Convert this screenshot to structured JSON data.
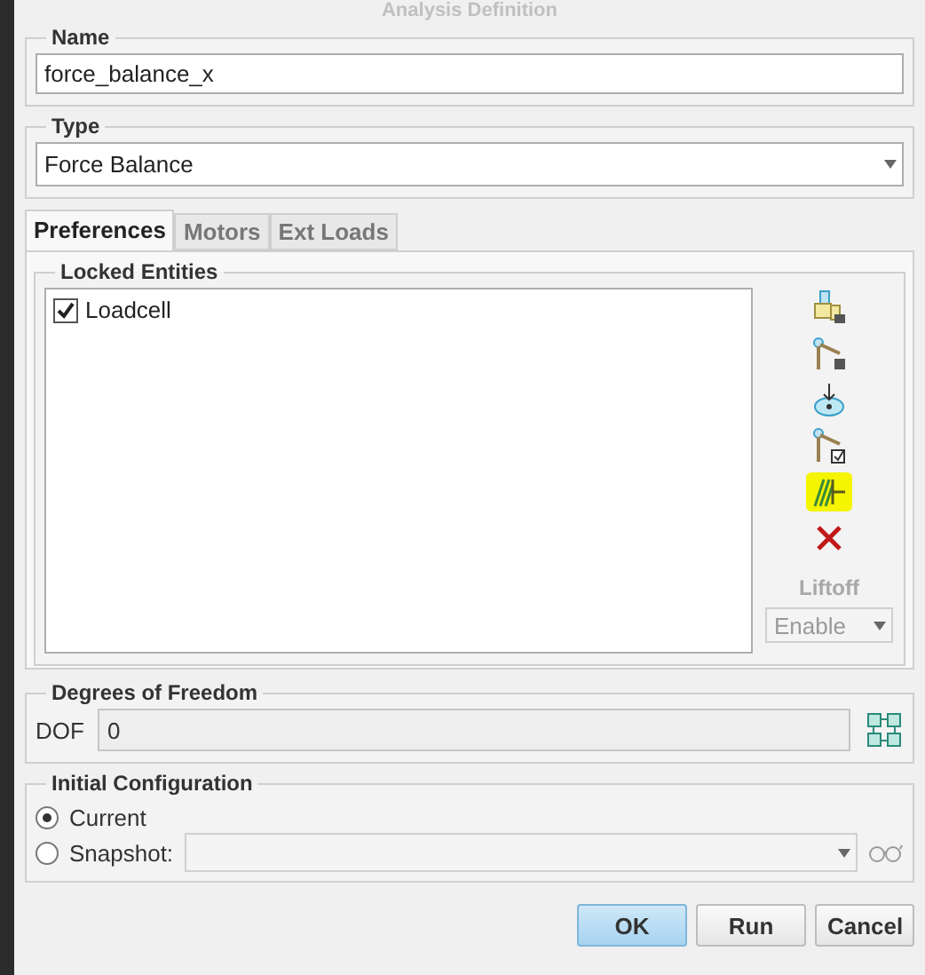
{
  "window": {
    "title": "Analysis Definition"
  },
  "name_group": {
    "label": "Name",
    "value": "force_balance_x"
  },
  "type_group": {
    "label": "Type",
    "value": "Force Balance"
  },
  "tabs": [
    {
      "label": "Preferences",
      "selected": true
    },
    {
      "label": "Motors",
      "selected": false
    },
    {
      "label": "Ext Loads",
      "selected": false
    }
  ],
  "locked_entities": {
    "label": "Locked Entities",
    "items": [
      {
        "label": "Loadcell",
        "checked": true
      }
    ],
    "tools": [
      {
        "kind": "body",
        "highlighted": false
      },
      {
        "kind": "link",
        "highlighted": false
      },
      {
        "kind": "point",
        "highlighted": false
      },
      {
        "kind": "check",
        "highlighted": false
      },
      {
        "kind": "wall",
        "highlighted": true
      },
      {
        "kind": "delete",
        "highlighted": false
      }
    ],
    "liftoff": {
      "label": "Liftoff",
      "value": "Enable",
      "disabled": true
    }
  },
  "dof_group": {
    "label": "Degrees of Freedom",
    "field_label": "DOF",
    "value": "0"
  },
  "initial_configuration": {
    "label": "Initial Configuration",
    "options": [
      {
        "label": "Current",
        "selected": true
      },
      {
        "label": "Snapshot:",
        "selected": false
      }
    ]
  },
  "buttons": [
    {
      "label": "OK",
      "primary": true
    },
    {
      "label": "Run",
      "primary": false
    },
    {
      "label": "Cancel",
      "primary": false
    }
  ]
}
